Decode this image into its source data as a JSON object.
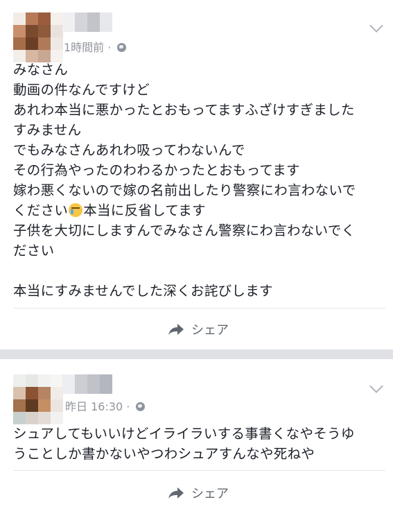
{
  "posts": [
    {
      "timestamp": "1時間前",
      "lines": [
        "みなさん",
        "動画の件なんですけど",
        "あれわ本当に悪かったとおもってますふざけすぎました",
        "すみません",
        "でもみなさんあれわ吸ってわないんで",
        "その行為やったのわわるかったとおもってます",
        "嫁わ悪くないので嫁の名前出したり警察にわ言わないで",
        "ください",
        "本当に反省してます",
        "子供を大切にしますんでみなさん警察にわ言わないでく",
        "ださい",
        "本当にすみませんでした深くお詫びします"
      ],
      "emoji_name": "crying-face-emoji",
      "share_label": "シェア"
    },
    {
      "timestamp": "昨日 16:30",
      "lines": [
        "シュアしてもいいけどイライラいする事書くなやそうゆ",
        "うことしか書かないやつわシュアすんなや死ねや"
      ],
      "share_label": "シェア"
    }
  ],
  "icons": {
    "privacy": "globe-icon",
    "menu": "chevron-down-icon",
    "share": "share-arrow-icon"
  },
  "colors": {
    "meta_text": "#90949c",
    "share_text": "#616770",
    "separator": "#dfe1e6"
  }
}
